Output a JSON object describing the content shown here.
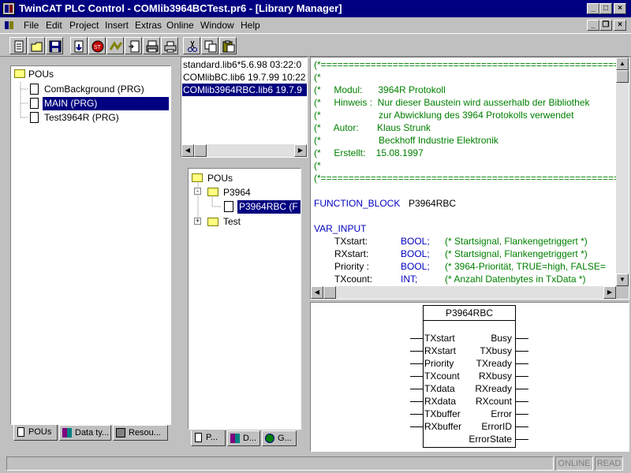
{
  "window": {
    "title": "TwinCAT PLC Control - COMlib3964BCTest.pr6 - [Library Manager]"
  },
  "menu": {
    "items": [
      "File",
      "Edit",
      "Project",
      "Insert",
      "Extras",
      "Online",
      "Window",
      "Help"
    ]
  },
  "toolbar": {
    "buttons": [
      "new-file-icon",
      "open-folder-icon",
      "save-icon",
      "build-icon",
      "stop-icon",
      "run-icon",
      "step-icon",
      "print-icon",
      "printer-icon",
      "cut-icon",
      "copy-icon",
      "paste-icon"
    ]
  },
  "left_panel": {
    "tree": {
      "root": "POUs",
      "items": [
        "ComBackground (PRG)",
        "MAIN (PRG)",
        "Test3964R (PRG)"
      ],
      "selected_index": 1
    },
    "tabs": [
      "POUs",
      "Data ty...",
      "Resou..."
    ]
  },
  "libraries": {
    "items": [
      "standard.lib6*5.6.98 03:22:0",
      "COMlibBC.lib6 19.7.99 10:22",
      "COMlib3964RBC.lib6 19.7.9"
    ],
    "selected_index": 2
  },
  "lib_tree": {
    "root": "POUs",
    "folder1": "P3964",
    "leaf": "P3964RBC (F",
    "folder2": "Test",
    "tabs": [
      "P...",
      "D...",
      "G..."
    ]
  },
  "code": {
    "separator": "(*============================================================",
    "header": [
      "(*",
      "(*     Modul:      3964R Protokoll",
      "(*     Hinweis :  Nur dieser Baustein wird ausserhalb der Bibliothek",
      "(*                      zur Abwicklung des 3964 Protokolls verwendet",
      "(*     Autor:       Klaus Strunk",
      "(*                      Beckhoff Industrie Elektronik",
      "(*     Erstellt:    15.08.1997",
      "(*"
    ],
    "fb_keyword": "FUNCTION_BLOCK",
    "fb_name": "P3964RBC",
    "var_input": "VAR_INPUT",
    "vars": [
      {
        "name": "TXstart:",
        "type": "BOOL;",
        "comment": "(* Startsignal, Flankengetriggert *)"
      },
      {
        "name": "RXstart:",
        "type": "BOOL;",
        "comment": "(* Startsignal, Flankengetriggert *)"
      },
      {
        "name": "Priority :",
        "type": "BOOL;",
        "comment": "(* 3964-Priorität, TRUE=high, FALSE="
      },
      {
        "name": "TXcount:",
        "type": "INT;",
        "comment": "(* Anzahl Datenbytes in TxData *)"
      }
    ]
  },
  "fb_diagram": {
    "title": "P3964RBC",
    "inputs": [
      "TXstart",
      "RXstart",
      "Priority",
      "TXcount",
      "TXdata",
      "RXdata",
      "TXbuffer",
      "RXbuffer"
    ],
    "outputs": [
      "Busy",
      "TXbusy",
      "TXready",
      "RXbusy",
      "RXready",
      "RXcount",
      "Error",
      "ErrorID",
      "ErrorState"
    ]
  },
  "status": {
    "online": "ONLINE",
    "read": "READ"
  },
  "colors": {
    "title_bg": "#000080",
    "comment": "#008000",
    "keyword": "#0000c0"
  }
}
